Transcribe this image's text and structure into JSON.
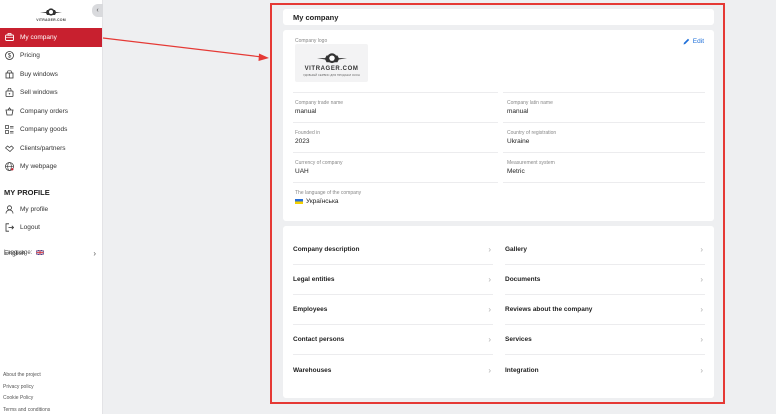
{
  "sidebar": {
    "logo_text": "VITRAGER.COM",
    "collapse_icon": "chevron-left-icon",
    "nav": [
      {
        "label": "My company",
        "icon": "briefcase-icon",
        "active": true
      },
      {
        "label": "Pricing",
        "icon": "dollar-icon"
      },
      {
        "label": "Buy windows",
        "icon": "cart-icon"
      },
      {
        "label": "Sell windows",
        "icon": "lock-bag-icon"
      },
      {
        "label": "Company orders",
        "icon": "basket-icon"
      },
      {
        "label": "Company goods",
        "icon": "grid-list-icon"
      },
      {
        "label": "Clients/partners",
        "icon": "handshake-icon"
      },
      {
        "label": "My webpage",
        "icon": "globe-icon"
      }
    ],
    "profile_title": "MY PROFILE",
    "profile_nav": [
      {
        "label": "My profile",
        "icon": "user-icon"
      },
      {
        "label": "Logout",
        "icon": "logout-icon"
      }
    ],
    "language_label": "Language:",
    "language_value": "English",
    "footer": [
      "About the project",
      "Privacy policy",
      "Cookie Policy",
      "Terms and conditions"
    ]
  },
  "main": {
    "title": "My company",
    "edit_label": "Edit",
    "logo_label": "Company logo",
    "logo_box_title": "VITRAGER.COM",
    "logo_box_sub": "УДОБНЫЙ СЕРВИС ДЛЯ ПРОДАЖИ ОКОН",
    "fields": {
      "trade_name_label": "Company trade name",
      "trade_name_value": "manual",
      "latin_name_label": "Company latin name",
      "latin_name_value": "manual",
      "founded_label": "Founded in",
      "founded_value": "2023",
      "country_label": "Country of registration",
      "country_value": "Ukraine",
      "currency_label": "Currency of company",
      "currency_value": "UAH",
      "measure_label": "Measurement system",
      "measure_value": "Metric",
      "language_label": "The language of the company",
      "language_value": "Українська"
    },
    "links_left": [
      "Company description",
      "Legal entities",
      "Employees",
      "Contact persons",
      "Warehouses"
    ],
    "links_right": [
      "Gallery",
      "Documents",
      "Reviews about the company",
      "Services",
      "Integration"
    ]
  },
  "colors": {
    "accent": "#c8202f",
    "highlight": "#e53935",
    "link": "#1e6fd9"
  }
}
